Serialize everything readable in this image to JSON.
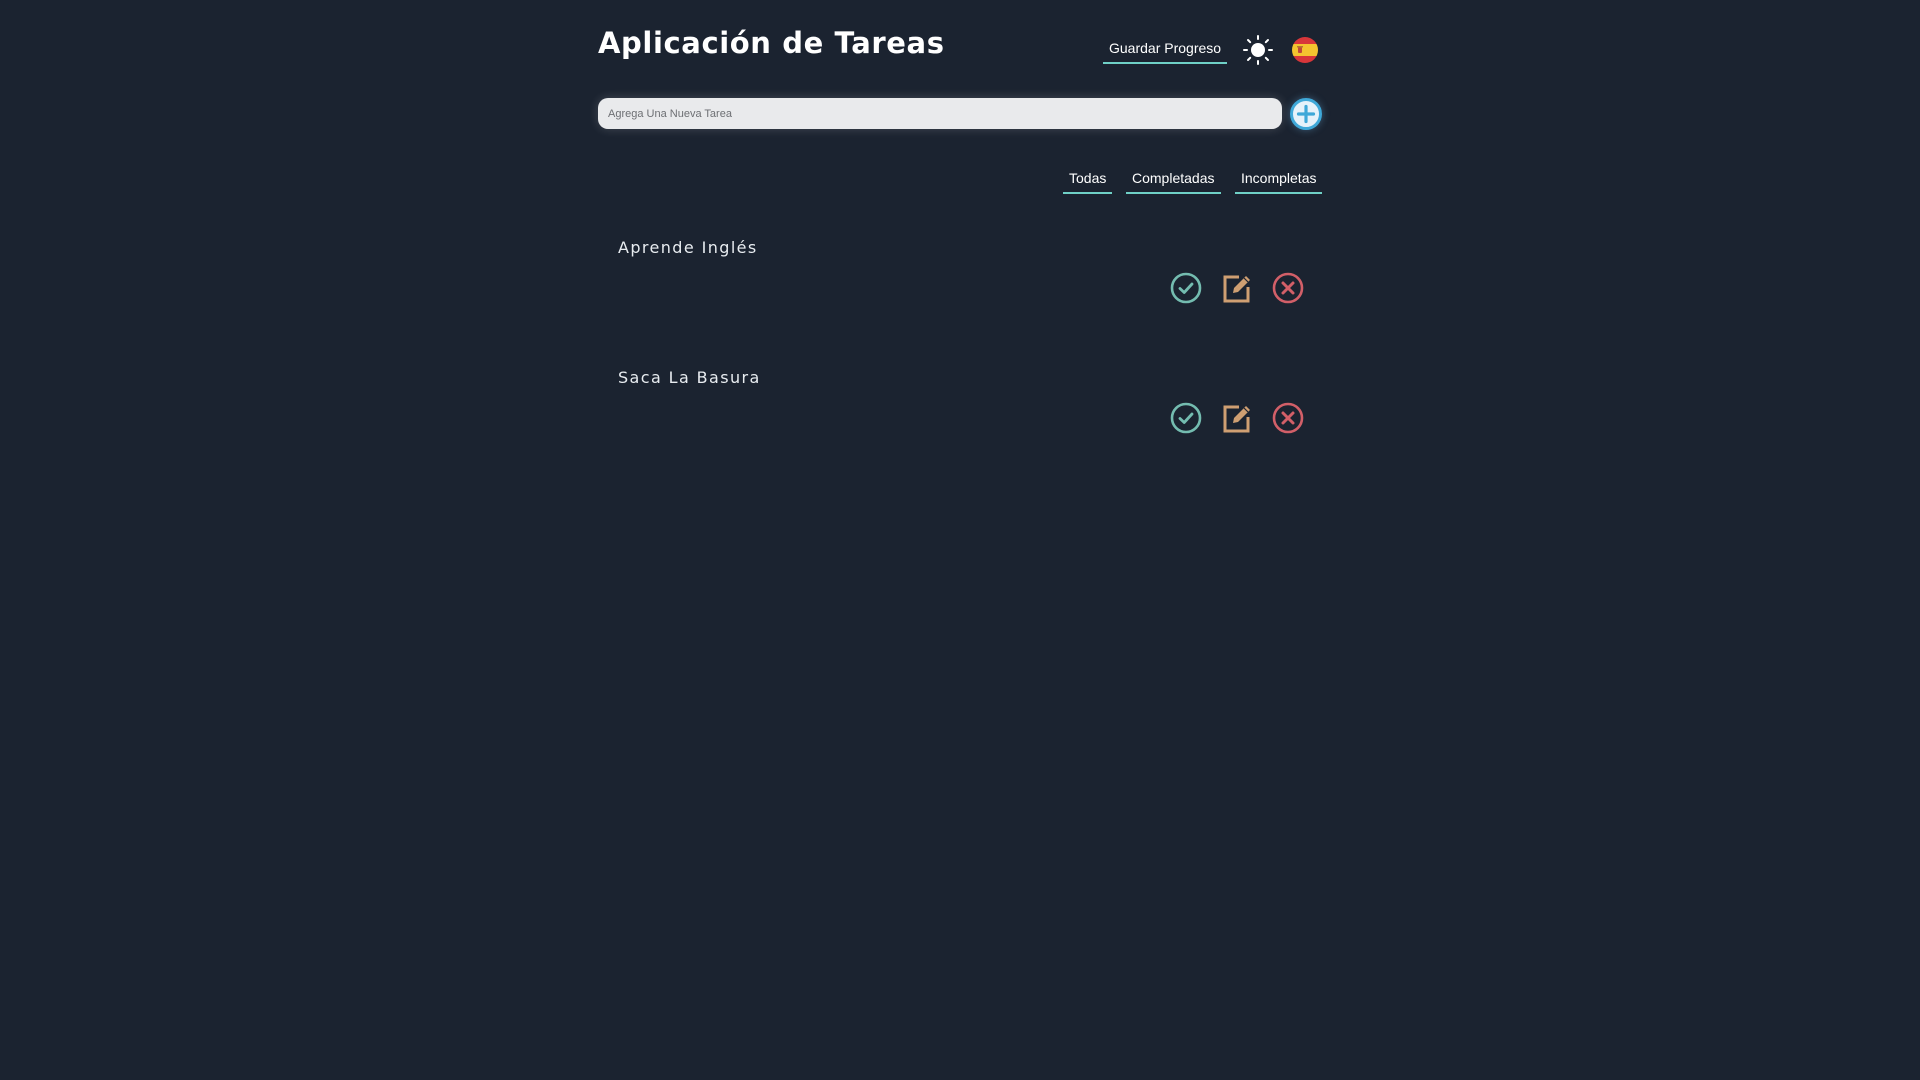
{
  "header": {
    "title": "Aplicación de Tareas",
    "save_label": "Guardar Progreso",
    "theme_icon": "sun-icon",
    "language_icon": "spain-flag-icon"
  },
  "new_task": {
    "placeholder": "Agrega Una Nueva Tarea",
    "value": "",
    "add_icon": "plus-circle-icon"
  },
  "filters": [
    {
      "label": "Todas"
    },
    {
      "label": "Completadas"
    },
    {
      "label": "Incompletas"
    }
  ],
  "tasks": [
    {
      "text": "Aprende Inglés"
    },
    {
      "text": "Saca La Basura"
    }
  ],
  "task_actions": {
    "complete_icon": "check-circle-icon",
    "edit_icon": "edit-icon",
    "delete_icon": "close-circle-icon"
  },
  "colors": {
    "background": "#1b2330",
    "accent": "#6fd0c6",
    "complete": "#74bcb0",
    "edit": "#cf9f72",
    "delete": "#d25f68",
    "add": "#3fa8d8"
  }
}
